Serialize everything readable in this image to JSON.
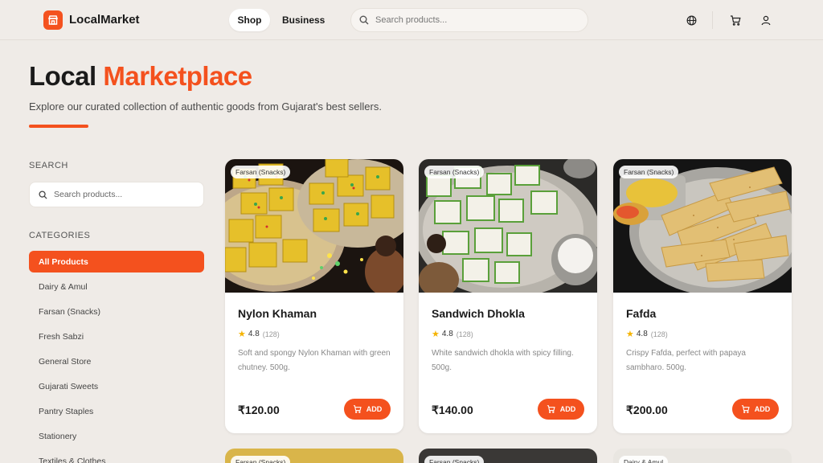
{
  "app": {
    "name": "LocalMarket"
  },
  "nav": {
    "shop": "Shop",
    "business": "Business"
  },
  "header": {
    "search_placeholder": "Search products..."
  },
  "hero": {
    "title_part1": "Local",
    "title_part2": "Marketplace",
    "subtitle": "Explore our curated collection of authentic goods from Gujarat's best sellers."
  },
  "sidebar": {
    "search_heading": "SEARCH",
    "search_placeholder": "Search products...",
    "categories_heading": "CATEGORIES",
    "categories": [
      {
        "label": "All Products",
        "active": true
      },
      {
        "label": "Dairy & Amul"
      },
      {
        "label": "Farsan (Snacks)"
      },
      {
        "label": "Fresh Sabzi"
      },
      {
        "label": "General Store"
      },
      {
        "label": "Gujarati Sweets"
      },
      {
        "label": "Pantry Staples"
      },
      {
        "label": "Stationery"
      },
      {
        "label": "Textiles & Clothes"
      }
    ]
  },
  "products": [
    {
      "category": "Farsan (Snacks)",
      "name": "Nylon Khaman",
      "rating": "4.8",
      "reviews": "(128)",
      "description": "Soft and spongy Nylon Khaman with green chutney. 500g.",
      "price": "₹120.00",
      "add_label": "ADD"
    },
    {
      "category": "Farsan (Snacks)",
      "name": "Sandwich Dhokla",
      "rating": "4.8",
      "reviews": "(128)",
      "description": "White sandwich dhokla with spicy filling. 500g.",
      "price": "₹140.00",
      "add_label": "ADD"
    },
    {
      "category": "Farsan (Snacks)",
      "name": "Fafda",
      "rating": "4.8",
      "reviews": "(128)",
      "description": "Crispy Fafda, perfect with papaya sambharo. 500g.",
      "price": "₹200.00",
      "add_label": "ADD"
    }
  ],
  "next_row": [
    {
      "category": "Farsan (Snacks)"
    },
    {
      "category": "Farsan (Snacks)"
    },
    {
      "category": "Dairy & Amul"
    }
  ],
  "colors": {
    "accent": "#f4511e",
    "background": "#efebe7",
    "star": "#f5b301"
  },
  "icons": [
    "store-icon",
    "search-icon",
    "globe-icon",
    "cart-icon",
    "user-icon",
    "star-icon"
  ]
}
